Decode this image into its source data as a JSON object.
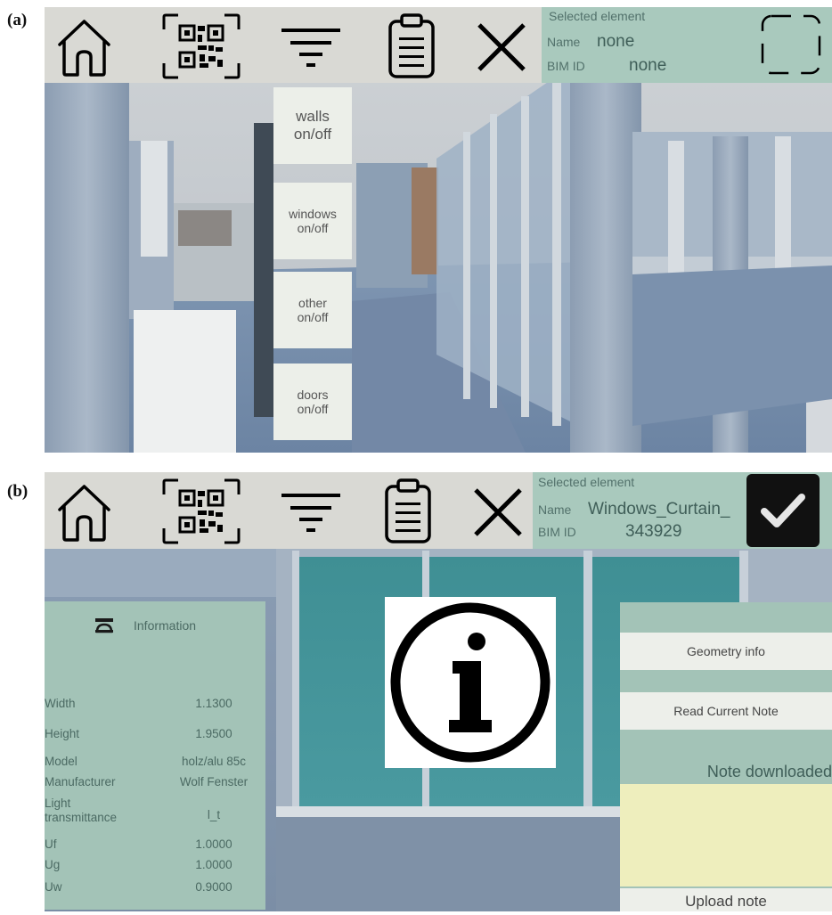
{
  "figure": {
    "label_a": "(a)",
    "label_b": "(b)"
  },
  "panel_a": {
    "toolbar_icons": [
      "home-icon",
      "qr-code-icon",
      "filter-icon",
      "clipboard-icon",
      "close-icon"
    ],
    "selected": {
      "title": "Selected element",
      "name_label": "Name",
      "name_value": "none",
      "bim_label": "BIM ID",
      "bim_value": "none"
    },
    "select_icon": "dashed-selection-icon",
    "filter_menu": [
      "walls\non/off",
      "windows\non/off",
      "other\non/off",
      "doors\non/off"
    ]
  },
  "panel_b": {
    "toolbar_icons": [
      "home-icon",
      "qr-code-icon",
      "filter-icon",
      "clipboard-icon",
      "close-icon"
    ],
    "selected": {
      "title": "Selected element",
      "name_label": "Name",
      "name_value": "Windows_Curtain_",
      "bim_label": "BIM ID",
      "bim_value": "343929"
    },
    "confirm_icon": "checkmark-icon",
    "info_panel": {
      "title": "Information",
      "rows": [
        {
          "key": "Width",
          "value": "1.1300"
        },
        {
          "key": "Height",
          "value": "1.9500"
        },
        {
          "key": "Model",
          "value": "holz/alu 85c"
        },
        {
          "key": "Manufacturer",
          "value": "Wolf Fenster"
        },
        {
          "key": "Light\ntransmittance",
          "value": "l_t"
        },
        {
          "key": "Uf",
          "value": "1.0000"
        },
        {
          "key": "Ug",
          "value": "1.0000"
        },
        {
          "key": "Uw",
          "value": "0.9000"
        }
      ]
    },
    "center_icon": "info-icon",
    "right_panel": {
      "geometry_button": "Geometry info",
      "read_note_button": "Read Current Note",
      "status": "Note downloaded",
      "note_text": "",
      "upload_button": "Upload note"
    }
  },
  "colors": {
    "toolbar": "#d9d9d4",
    "selected_bg": "#a9c9bd",
    "info_bg": "#a3c3b7",
    "note_bg": "#eeeebd",
    "confirm_bg": "#111111"
  }
}
